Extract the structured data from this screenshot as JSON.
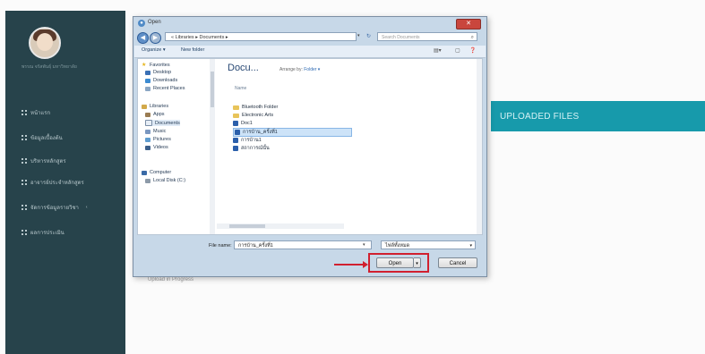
{
  "sidebar": {
    "username": "พรรณ จรัสพันธุ์ มหาวิทยาลัย",
    "items": [
      {
        "label": "หน้าแรก"
      },
      {
        "label": "ข้อมูลเบื้องต้น"
      },
      {
        "label": "บริหารหลักสูตร"
      },
      {
        "label": "อาจารย์ประจำหลักสูตร"
      },
      {
        "label": "จัดการข้อมูลรายวิชา",
        "caret": "‹"
      },
      {
        "label": "ผลการประเมิน"
      }
    ]
  },
  "page": {
    "banner": "UPLOADED FILES",
    "upload_progress": "Upload in Progress"
  },
  "dialog": {
    "title": "Open",
    "close": "✕",
    "breadcrumb": "« Libraries ▸ Documents ▸",
    "search_placeholder": "Search Documents",
    "toolbar": {
      "organize": "Organize ▾",
      "new_folder": "New folder"
    },
    "nav": {
      "favorites": "Favorites",
      "desktop": "Desktop",
      "downloads": "Downloads",
      "recent": "Recent Places",
      "libraries": "Libraries",
      "apps": "Apps",
      "documents": "Documents",
      "music": "Music",
      "pictures": "Pictures",
      "videos": "Videos",
      "computer": "Computer",
      "local_disk": "Local Disk (C:)"
    },
    "library_heading": "Docu...",
    "arrange_label": "Arrange by:",
    "arrange_value": "Folder ▾",
    "column_name": "Name",
    "files": [
      {
        "name": "Bluetooth Folder",
        "kind": "folder"
      },
      {
        "name": "Electronic Arts",
        "kind": "folder"
      },
      {
        "name": "Doc1",
        "kind": "doc"
      },
      {
        "name": "การบ้าน_ครั้งที่1",
        "kind": "doc",
        "selected": true
      },
      {
        "name": "การบ้าน1",
        "kind": "doc"
      },
      {
        "name": "สถาการณ์นั้น",
        "kind": "doc"
      }
    ],
    "file_name_label": "File name:",
    "file_name_value": "การบ้าน_ครั้งที่1",
    "file_type_value": "ไฟล์ทั้งหมด",
    "open_label": "Open",
    "cancel_label": "Cancel"
  }
}
